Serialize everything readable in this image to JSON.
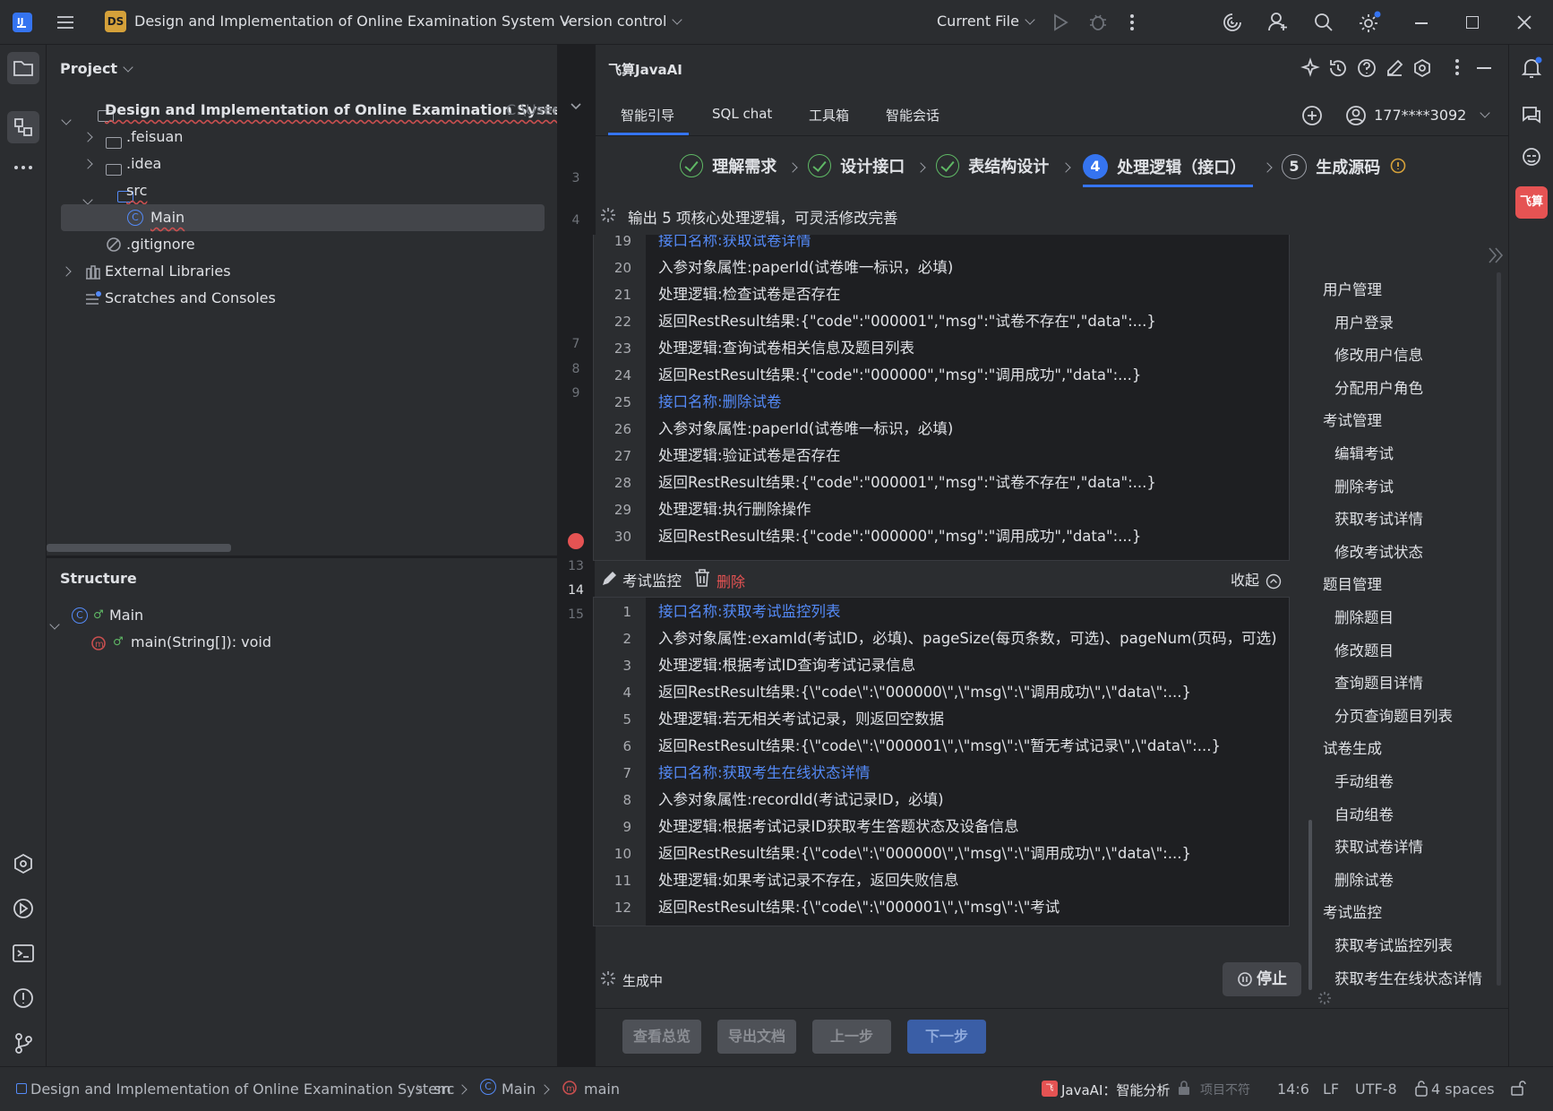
{
  "titlebar": {
    "project_badge": "DS",
    "project_name": "Design and Implementation of Online Examination System",
    "vcs": "Version control",
    "run_config": "Current File"
  },
  "project_panel": {
    "title": "Project",
    "root_name": "Design and Implementation of Online Examination System",
    "root_path": "C:\\User",
    "items": [
      {
        "label": ".feisuan"
      },
      {
        "label": ".idea"
      },
      {
        "label": "src"
      },
      {
        "label": "Main"
      },
      {
        "label": ".gitignore"
      },
      {
        "label": "External Libraries"
      },
      {
        "label": "Scratches and Consoles"
      }
    ]
  },
  "structure_panel": {
    "title": "Structure",
    "class_name": "Main",
    "method": "main(String[]): void"
  },
  "gutter": {
    "lines": [
      "3",
      "4",
      "7",
      "8",
      "9",
      "13",
      "14",
      "15"
    ]
  },
  "ai": {
    "title": "飞算JavaAI",
    "tabs": [
      "智能引导",
      "SQL chat",
      "工具箱",
      "智能会话"
    ],
    "account": "177****3092",
    "steps": [
      {
        "label": "理解需求"
      },
      {
        "label": "设计接口"
      },
      {
        "label": "表结构设计"
      },
      {
        "num": "4",
        "label": "处理逻辑（接口）"
      },
      {
        "num": "5",
        "label": "生成源码"
      }
    ],
    "status_line": "输出 5 项核心处理逻辑，可灵活修改完善",
    "block1": {
      "lines": [
        {
          "n": "19",
          "t": "接口名称:获取试卷详情"
        },
        {
          "n": "20",
          "t": "入参对象属性:paperId(试卷唯一标识，必填)"
        },
        {
          "n": "21",
          "t": "处理逻辑:检查试卷是否存在"
        },
        {
          "n": "22",
          "t": "返回RestResult结果:{\"code\":\"000001\",\"msg\":\"试卷不存在\",\"data\":...}"
        },
        {
          "n": "23",
          "t": "处理逻辑:查询试卷相关信息及题目列表"
        },
        {
          "n": "24",
          "t": "返回RestResult结果:{\"code\":\"000000\",\"msg\":\"调用成功\",\"data\":...}"
        },
        {
          "n": "25",
          "t": "接口名称:删除试卷"
        },
        {
          "n": "26",
          "t": "入参对象属性:paperId(试卷唯一标识，必填)"
        },
        {
          "n": "27",
          "t": "处理逻辑:验证试卷是否存在"
        },
        {
          "n": "28",
          "t": "返回RestResult结果:{\"code\":\"000001\",\"msg\":\"试卷不存在\",\"data\":...}"
        },
        {
          "n": "29",
          "t": "处理逻辑:执行删除操作"
        },
        {
          "n": "30",
          "t": "返回RestResult结果:{\"code\":\"000000\",\"msg\":\"调用成功\",\"data\":...}"
        }
      ]
    },
    "section2": {
      "title": "考试监控",
      "delete": "删除",
      "collapse": "收起"
    },
    "block2": {
      "lines": [
        {
          "n": "1",
          "t": "接口名称:获取考试监控列表"
        },
        {
          "n": "2",
          "t": "入参对象属性:examId(考试ID，必填)、pageSize(每页条数，可选)、pageNum(页码，可选)"
        },
        {
          "n": "3",
          "t": "处理逻辑:根据考试ID查询考试记录信息"
        },
        {
          "n": "4",
          "t": "返回RestResult结果:{\\\"code\\\":\\\"000000\\\",\\\"msg\\\":\\\"调用成功\\\",\\\"data\\\":...}"
        },
        {
          "n": "5",
          "t": "处理逻辑:若无相关考试记录，则返回空数据"
        },
        {
          "n": "6",
          "t": "返回RestResult结果:{\\\"code\\\":\\\"000001\\\",\\\"msg\\\":\\\"暂无考试记录\\\",\\\"data\\\":...}"
        },
        {
          "n": "7",
          "t": "接口名称:获取考生在线状态详情"
        },
        {
          "n": "8",
          "t": "入参对象属性:recordId(考试记录ID，必填)"
        },
        {
          "n": "9",
          "t": "处理逻辑:根据考试记录ID获取考生答题状态及设备信息"
        },
        {
          "n": "10",
          "t": "返回RestResult结果:{\\\"code\\\":\\\"000000\\\",\\\"msg\\\":\\\"调用成功\\\",\\\"data\\\":...}"
        },
        {
          "n": "11",
          "t": "处理逻辑:如果考试记录不存在，返回失败信息"
        },
        {
          "n": "12",
          "t": "返回RestResult结果:{\\\"code\\\":\\\"000001\\\",\\\"msg\\\":\\\"考试"
        }
      ]
    },
    "generating": "生成中",
    "stop": "停止",
    "buttons": {
      "overview": "查看总览",
      "export": "导出文档",
      "prev": "上一步",
      "next": "下一步"
    },
    "outline": [
      {
        "label": "用户管理",
        "level": 0
      },
      {
        "label": "用户登录",
        "level": 1
      },
      {
        "label": "修改用户信息",
        "level": 1
      },
      {
        "label": "分配用户角色",
        "level": 1
      },
      {
        "label": "考试管理",
        "level": 0
      },
      {
        "label": "编辑考试",
        "level": 1
      },
      {
        "label": "删除考试",
        "level": 1
      },
      {
        "label": "获取考试详情",
        "level": 1
      },
      {
        "label": "修改考试状态",
        "level": 1
      },
      {
        "label": "题目管理",
        "level": 0
      },
      {
        "label": "删除题目",
        "level": 1
      },
      {
        "label": "修改题目",
        "level": 1
      },
      {
        "label": "查询题目详情",
        "level": 1
      },
      {
        "label": "分页查询题目列表",
        "level": 1
      },
      {
        "label": "试卷生成",
        "level": 0
      },
      {
        "label": "手动组卷",
        "level": 1
      },
      {
        "label": "自动组卷",
        "level": 1
      },
      {
        "label": "获取试卷详情",
        "level": 1
      },
      {
        "label": "删除试卷",
        "level": 1
      },
      {
        "label": "考试监控",
        "level": 0
      },
      {
        "label": "获取考试监控列表",
        "level": 1
      },
      {
        "label": "获取考生在线状态详情",
        "level": 1
      }
    ]
  },
  "right_strip": {
    "badge": "飞算"
  },
  "status": {
    "breadcrumb": [
      "Design and Implementation of Online Examination System",
      "src",
      "Main",
      "main"
    ],
    "javaai": "JavaAI：智能分析",
    "project_note": "项目不符",
    "position": "14:6",
    "line_sep": "LF",
    "encoding": "UTF-8",
    "indent": "4 spaces"
  },
  "colors": {
    "accent": "#3574f0",
    "link": "#548af7",
    "ok": "#5fb865",
    "danger": "#e55353",
    "warn": "#d5a13a"
  }
}
